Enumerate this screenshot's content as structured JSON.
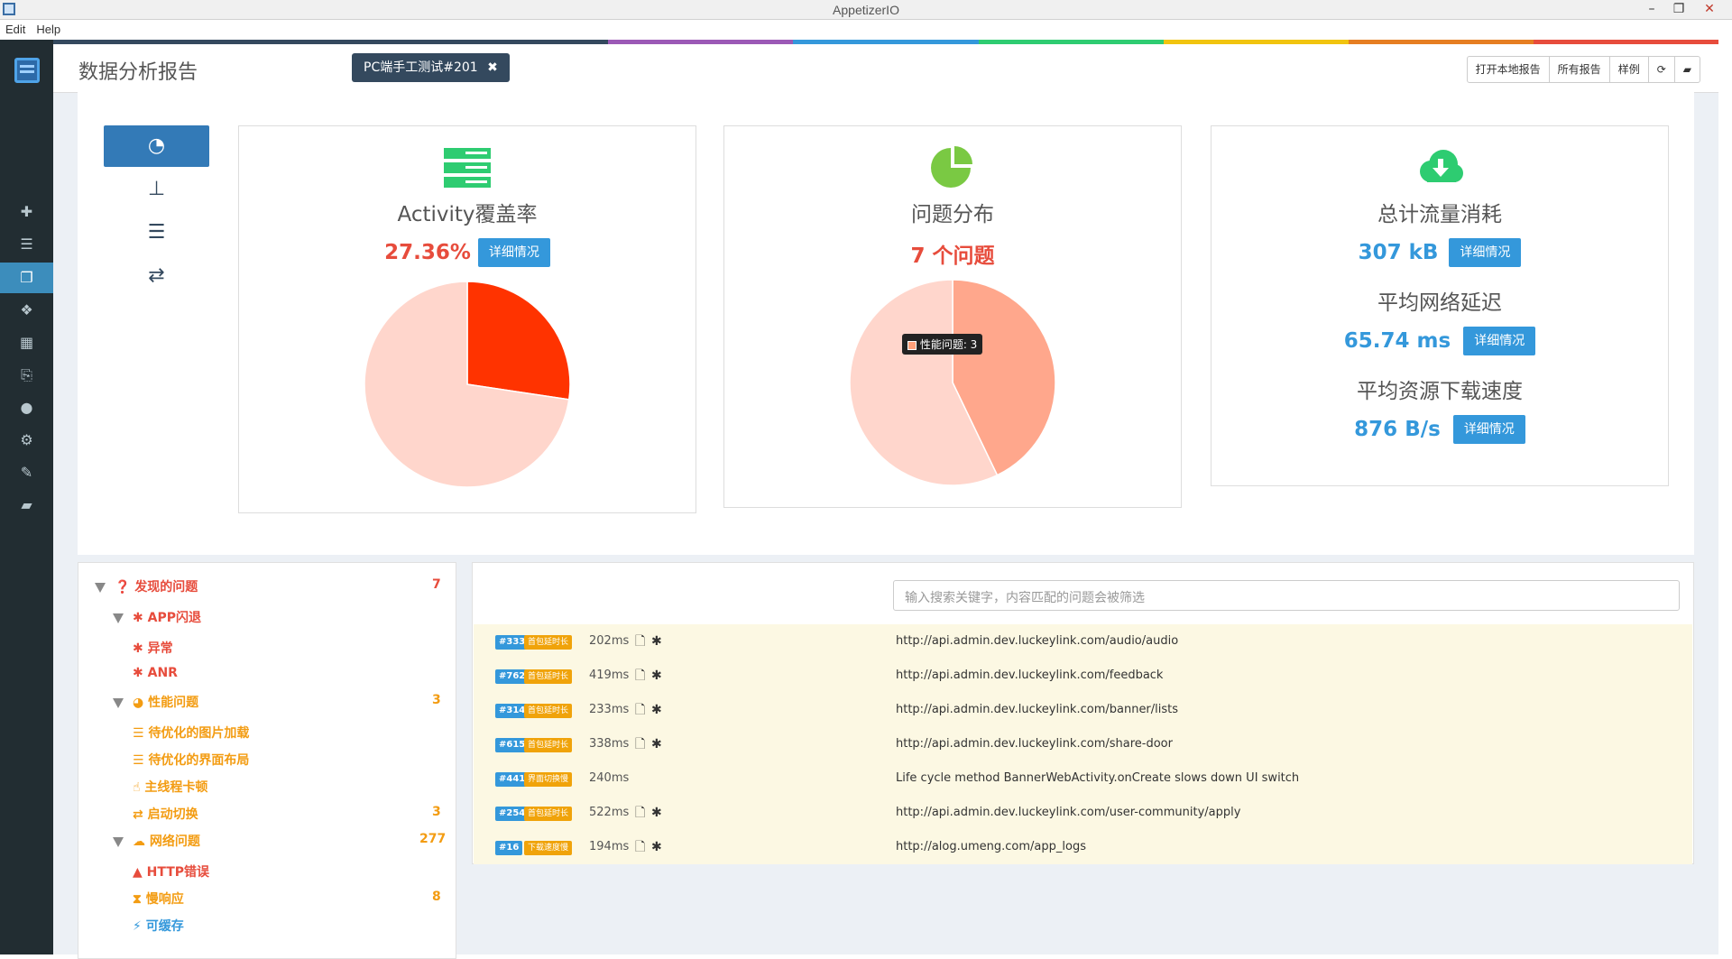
{
  "window": {
    "title": "AppetizerIO"
  },
  "menu": [
    "Edit",
    "Help"
  ],
  "header": {
    "title": "数据分析报告",
    "test_tag": "PC端手工测试#201",
    "buttons": [
      "打开本地报告",
      "所有报告",
      "样例"
    ]
  },
  "colors": {
    "strip": [
      "#34495e",
      "#34495e",
      "#34495e",
      "#9b59b6",
      "#3498db",
      "#2ecc71",
      "#f1c40f",
      "#e67e22",
      "#e74c3c"
    ],
    "accent_blue": "#3498db",
    "red": "#e74c3c",
    "orange": "#f39c12"
  },
  "cards": {
    "coverage": {
      "title": "Activity覆盖率",
      "value": "27.36%",
      "btn": "详细情况",
      "chart": {
        "type": "pie",
        "values": [
          27.36,
          72.64
        ]
      }
    },
    "issues": {
      "title": "问题分布",
      "value": "7 个问题",
      "tooltip": "性能问题: 3",
      "chart": {
        "type": "pie",
        "values": [
          3,
          4
        ]
      }
    },
    "traffic": {
      "title": "总计流量消耗",
      "value": "307 kB",
      "btn": "详细情况",
      "latency_title": "平均网络延迟",
      "latency_value": "65.74 ms",
      "latency_btn": "详细情况",
      "speed_title": "平均资源下载速度",
      "speed_value": "876 B/s",
      "speed_btn": "详细情况"
    }
  },
  "tree": {
    "root": {
      "label": "发现的问题",
      "count": "7"
    },
    "crash": {
      "label": "APP闪退",
      "children": [
        "异常",
        "ANR"
      ]
    },
    "perf": {
      "label": "性能问题",
      "count": "3",
      "children": [
        "待优化的图片加载",
        "待优化的界面布局",
        "主线程卡顿",
        "启动切换"
      ],
      "switch_count": "3"
    },
    "net": {
      "label": "网络问题",
      "count": "277",
      "children": [
        "HTTP错误",
        "慢响应",
        "可缓存"
      ],
      "slow_count": "8"
    }
  },
  "search": {
    "placeholder": "输入搜索关键字，内容匹配的问题会被筛选"
  },
  "issues": [
    {
      "id": "#333",
      "type": "首包延时长",
      "latency": "202ms",
      "text": "http://api.admin.dev.luckeylink.com/audio/audio",
      "icons": true
    },
    {
      "id": "#762",
      "type": "首包延时长",
      "latency": "419ms",
      "text": "http://api.admin.dev.luckeylink.com/feedback",
      "icons": true
    },
    {
      "id": "#314",
      "type": "首包延时长",
      "latency": "233ms",
      "text": "http://api.admin.dev.luckeylink.com/banner/lists",
      "icons": true
    },
    {
      "id": "#615",
      "type": "首包延时长",
      "latency": "338ms",
      "text": "http://api.admin.dev.luckeylink.com/share-door",
      "icons": true
    },
    {
      "id": "#441",
      "type": "界面切换慢",
      "latency": "240ms",
      "text": "Life cycle method BannerWebActivity.onCreate slows down UI switch",
      "icons": false
    },
    {
      "id": "#254",
      "type": "首包延时长",
      "latency": "522ms",
      "text": "http://api.admin.dev.luckeylink.com/user-community/apply",
      "icons": true
    },
    {
      "id": "#16",
      "type": "下载速度慢",
      "latency": "194ms",
      "text": "http://alog.umeng.com/app_logs",
      "icons": true
    }
  ]
}
